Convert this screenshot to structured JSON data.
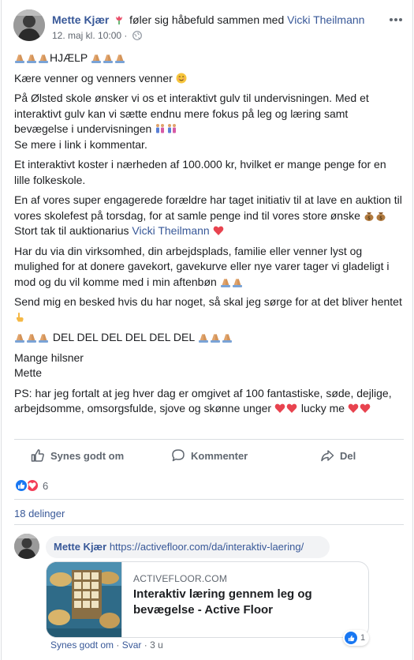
{
  "post": {
    "author": "Mette Kjær",
    "feeling": "føler sig håbefuld sammen med",
    "tagged": "Vicki Theilmann",
    "timestamp": "12. maj kl. 10:00",
    "dot": "·",
    "paragraphs": {
      "p1_text": "HJÆLP",
      "p2": "Kære venner og venners venner",
      "p3a": "På Ølsted skole ønsker vi os et interaktivt gulv til undervisningen. Med et interaktivt gulv kan vi sætte endnu mere fokus på leg og læring samt bevægelse i undervisningen",
      "p3b": "Se mere i link i kommentar.",
      "p4": "Et interaktivt koster i nærheden af 100.000 kr, hvilket er mange penge for en lille folkeskole.",
      "p5a": "En af vores super engagerede forældre har taget initiativ til at lave en auktion til vores skolefest på torsdag, for at samle penge ind til vores store ønske",
      "p5b": "Stort tak til auktionarius",
      "p5_mention": "Vicki Theilmann",
      "p6": "Har du via din virksomhed, din arbejdsplads, familie eller venner lyst og mulighed for at donere gavekort, gavekurve eller nye varer tager vi gladeligt i mod og du vil komme med i min aftenbøn",
      "p7": "Send mig en besked hvis du har noget, så skal jeg sørge for at det bliver hentet",
      "p8": "DEL DEL DEL DEL DEL DEL",
      "p9a": "Mange hilsner",
      "p9b": "Mette",
      "p10a": "PS: har jeg fortalt at jeg hver dag er omgivet af 100 fantastiske, søde, dejlige, arbejdsomme, omsorgsfulde, sjove og skønne unger",
      "p10b": "lucky me"
    }
  },
  "actions": {
    "like": "Synes godt om",
    "comment": "Kommenter",
    "share": "Del"
  },
  "reactions": {
    "count": "6",
    "shares": "18 delinger"
  },
  "comment": {
    "author": "Mette Kjær",
    "url": "https://activefloor.com/da/interaktiv-laering/",
    "card_domain": "ACTIVEFLOOR.COM",
    "card_title": "Interaktiv læring gennem leg og bevægelse - Active Floor",
    "reaction_count": "1",
    "like": "Synes godt om",
    "dot": "·",
    "reply": "Svar",
    "age": "3 u"
  },
  "icons": [
    "tulip-icon",
    "globe-icon",
    "more-icon",
    "praying-hands-icon",
    "smile-icon",
    "people-icon",
    "money-bag-icon",
    "heart-icon",
    "pointing-hand-icon",
    "like-icon",
    "comment-icon",
    "share-icon",
    "love-icon"
  ],
  "colors": {
    "link": "#385898",
    "like_blue": "#1877f2",
    "love_red": "#f33e58",
    "text": "#1c1e21",
    "muted": "#606770"
  }
}
